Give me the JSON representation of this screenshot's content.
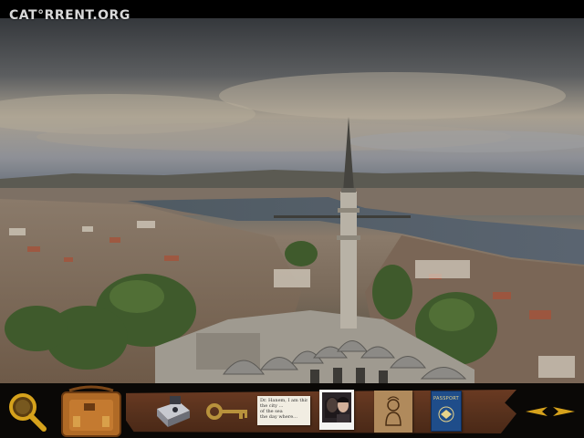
{
  "watermark": {
    "text": "CAT°RRENT.ORG"
  },
  "scene": {
    "name": "istanbul-city-view"
  },
  "inventory": {
    "passport_label": "PASSPORT",
    "note_lines": [
      "Dr. Hanem, I am thinking of",
      "the city ...",
      "of the sea",
      "the day where..."
    ],
    "items": [
      "magnifier",
      "bag",
      "camera",
      "key",
      "note",
      "photo",
      "drawing",
      "passport"
    ]
  },
  "colors": {
    "bar_bg": "#0a0806",
    "strip": "#5a321c",
    "gold": "#d6a21c",
    "passport_blue": "#1f4d8a"
  }
}
